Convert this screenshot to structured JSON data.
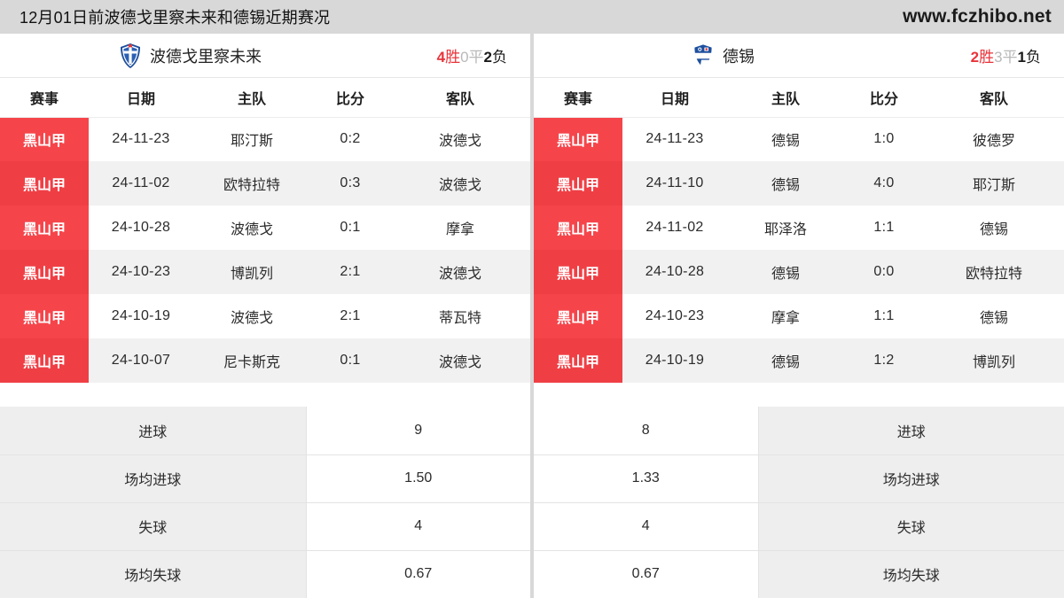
{
  "header": {
    "title": "12月01日前波德戈里察未来和德锡近期赛况",
    "site": "www.fczhibo.net"
  },
  "left": {
    "team": {
      "name": "波德戈里察未来",
      "crest_icon": "shield-crest-icon",
      "record": {
        "wins": "4",
        "wins_label": "胜",
        "draws": "0",
        "draws_label": "平",
        "losses": "2",
        "losses_label": "负"
      }
    },
    "columns": [
      "赛事",
      "日期",
      "主队",
      "比分",
      "客队"
    ],
    "rows": [
      {
        "league": "黑山甲",
        "date": "24-11-23",
        "home": "耶汀斯",
        "score": "0:2",
        "away": "波德戈"
      },
      {
        "league": "黑山甲",
        "date": "24-11-02",
        "home": "欧特拉特",
        "score": "0:3",
        "away": "波德戈"
      },
      {
        "league": "黑山甲",
        "date": "24-10-28",
        "home": "波德戈",
        "score": "0:1",
        "away": "摩拿"
      },
      {
        "league": "黑山甲",
        "date": "24-10-23",
        "home": "博凯列",
        "score": "2:1",
        "away": "波德戈"
      },
      {
        "league": "黑山甲",
        "date": "24-10-19",
        "home": "波德戈",
        "score": "2:1",
        "away": "蒂瓦特"
      },
      {
        "league": "黑山甲",
        "date": "24-10-07",
        "home": "尼卡斯克",
        "score": "0:1",
        "away": "波德戈"
      }
    ],
    "stats": [
      {
        "label": "进球",
        "value": "9"
      },
      {
        "label": "场均进球",
        "value": "1.50"
      },
      {
        "label": "失球",
        "value": "4"
      },
      {
        "label": "场均失球",
        "value": "0.67"
      }
    ]
  },
  "right": {
    "team": {
      "name": "德锡",
      "crest_icon": "shield-crest-icon",
      "record": {
        "wins": "2",
        "wins_label": "胜",
        "draws": "3",
        "draws_label": "平",
        "losses": "1",
        "losses_label": "负"
      }
    },
    "columns": [
      "赛事",
      "日期",
      "主队",
      "比分",
      "客队"
    ],
    "rows": [
      {
        "league": "黑山甲",
        "date": "24-11-23",
        "home": "德锡",
        "score": "1:0",
        "away": "彼德罗"
      },
      {
        "league": "黑山甲",
        "date": "24-11-10",
        "home": "德锡",
        "score": "4:0",
        "away": "耶汀斯"
      },
      {
        "league": "黑山甲",
        "date": "24-11-02",
        "home": "耶泽洛",
        "score": "1:1",
        "away": "德锡"
      },
      {
        "league": "黑山甲",
        "date": "24-10-28",
        "home": "德锡",
        "score": "0:0",
        "away": "欧特拉特"
      },
      {
        "league": "黑山甲",
        "date": "24-10-23",
        "home": "摩拿",
        "score": "1:1",
        "away": "德锡"
      },
      {
        "league": "黑山甲",
        "date": "24-10-19",
        "home": "德锡",
        "score": "1:2",
        "away": "博凯列"
      }
    ],
    "stats": [
      {
        "label": "进球",
        "value": "8"
      },
      {
        "label": "场均进球",
        "value": "1.33"
      },
      {
        "label": "失球",
        "value": "4"
      },
      {
        "label": "场均失球",
        "value": "0.67"
      }
    ]
  },
  "colors": {
    "league_badge": "#f5454b",
    "league_badge_alt": "#ef3f45",
    "record_win": "#e8333a",
    "record_draw": "#b9b9b9",
    "record_loss": "#1a1a1a",
    "page_bg": "#d8d8d8",
    "row_alt": "#f1f1f1",
    "stat_label_bg": "#eeeeee"
  }
}
